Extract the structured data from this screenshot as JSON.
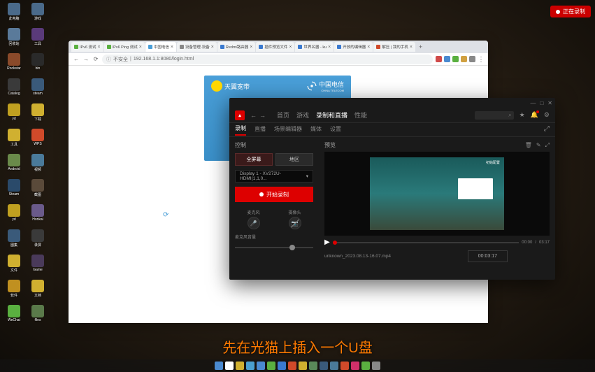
{
  "recording_badge": "正在录制",
  "desktop": {
    "icons": [
      {
        "label": "此电脑",
        "color": "#4a6a8a"
      },
      {
        "label": "回收站",
        "color": "#5a7a9a"
      },
      {
        "label": "Rockstar",
        "color": "#8a4a2a"
      },
      {
        "label": "Catalog",
        "color": "#3a3a3a"
      },
      {
        "label": "yd",
        "color": "#c0a020"
      },
      {
        "label": "工具",
        "color": "#d0b030"
      },
      {
        "label": "Android",
        "color": "#6a8a4a"
      },
      {
        "label": "Steam",
        "color": "#2a4a6a"
      },
      {
        "label": "yd",
        "color": "#c0a020"
      },
      {
        "label": "图集",
        "color": "#3a5a7a"
      },
      {
        "label": "文件",
        "color": "#d0b030"
      },
      {
        "label": "软件",
        "color": "#c09020"
      },
      {
        "label": "WeChat",
        "color": "#5ab040"
      },
      {
        "label": "游戏",
        "color": "#4a6a8a"
      },
      {
        "label": "工具",
        "color": "#5a3a7a"
      },
      {
        "label": "bin",
        "color": "#2a2a2a"
      },
      {
        "label": "steam",
        "color": "#3a5a7a"
      },
      {
        "label": "下载",
        "color": "#d0b030"
      },
      {
        "label": "WPS",
        "color": "#d04a2a"
      },
      {
        "label": "视频",
        "color": "#4a7a9a"
      },
      {
        "label": "截图",
        "color": "#5a4a3a"
      },
      {
        "label": "Honkai",
        "color": "#6a5a8a"
      },
      {
        "label": "录屏",
        "color": "#3a3a3a"
      },
      {
        "label": "Game",
        "color": "#4a3a5a"
      },
      {
        "label": "文档",
        "color": "#d0b030"
      },
      {
        "label": "files",
        "color": "#5a7a4a"
      }
    ]
  },
  "browser": {
    "tabs": [
      {
        "label": "IPv6 测试",
        "favicon": "#5ab040"
      },
      {
        "label": "IPv6 Ping 测试",
        "favicon": "#5ab040"
      },
      {
        "label": "中国电信",
        "favicon": "#4a9fd8"
      },
      {
        "label": "设备管理-设备",
        "favicon": "#888"
      },
      {
        "label": "Redmi路由器",
        "favicon": "#3a7ad0"
      },
      {
        "label": "插件预览文件",
        "favicon": "#3a7ad0"
      },
      {
        "label": "世界名器 - ku",
        "favicon": "#3a7ad0"
      },
      {
        "label": "开放的编辑器",
        "favicon": "#3a7ad0"
      },
      {
        "label": "解压 | 我的手机",
        "favicon": "#d04a2a"
      }
    ],
    "new_tab": "+",
    "addr": {
      "insecure": "不安全",
      "url": "192.168.1.1:8080/login.html"
    },
    "telecom": {
      "brand_left": "天翼宽带",
      "brand_right": "中国电信",
      "brand_sub": "CHINA TELECOM"
    }
  },
  "amd": {
    "nav": {
      "back": "←",
      "forward": "→",
      "home": "首页",
      "games": "游戏"
    },
    "main_tabs": {
      "record": "录制和直播",
      "perf": "性能"
    },
    "header_icons": {
      "star": "★",
      "bell": "🔔",
      "settings": "⚙"
    },
    "subtabs": {
      "record": "录制",
      "stream": "直播",
      "scene": "场景编辑器",
      "media": "媒体",
      "settings": "设置"
    },
    "left": {
      "control": "控制",
      "fullscreen": "全屏幕",
      "region": "地区",
      "display_select": "Display 1 - XV272U- HDMI(1,1,0...",
      "start_record": "开始录制",
      "mic": "麦克风",
      "camera": "摄像头",
      "mic_volume": "麦克风音量"
    },
    "right": {
      "preview": "预览",
      "thumb_label": "初始配置",
      "time_current": "00:00",
      "time_total": "03:17",
      "clip_name": "unknown_2023.08.13-16.07.mp4",
      "duration": "00:03:17"
    }
  },
  "subtitle": "先在光猫上插入一个U盘",
  "taskbar": {
    "icons": [
      {
        "color": "#4a8ad0"
      },
      {
        "color": "#ffffff"
      },
      {
        "color": "#d0b030"
      },
      {
        "color": "#4aa0d0"
      },
      {
        "color": "#4a8ad0"
      },
      {
        "color": "#5ab040"
      },
      {
        "color": "#3a7ad0"
      },
      {
        "color": "#d04a2a"
      },
      {
        "color": "#d0b030"
      },
      {
        "color": "#5a8a5a"
      },
      {
        "color": "#3a5a7a"
      },
      {
        "color": "#4a7a9a"
      },
      {
        "color": "#d04a2a"
      },
      {
        "color": "#d0306a"
      },
      {
        "color": "#5ab040"
      },
      {
        "color": "#888888"
      }
    ]
  }
}
